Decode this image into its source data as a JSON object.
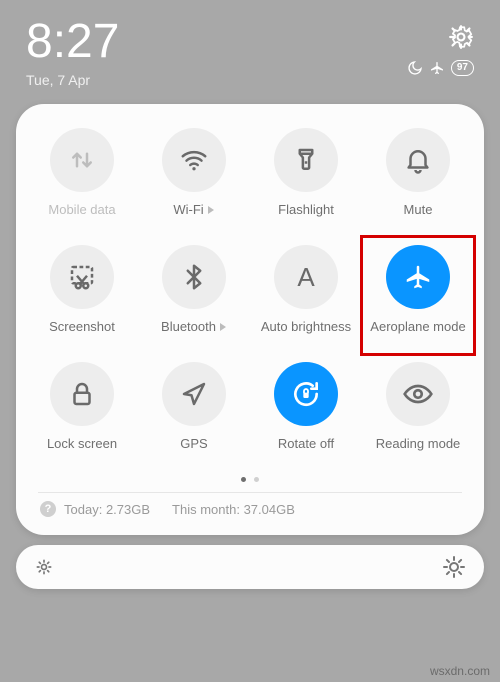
{
  "status": {
    "time": "8:27",
    "date": "Tue, 7 Apr",
    "battery": "97"
  },
  "tiles": {
    "mobile_data": "Mobile data",
    "wifi": "Wi-Fi",
    "flashlight": "Flashlight",
    "mute": "Mute",
    "screenshot": "Screenshot",
    "bluetooth": "Bluetooth",
    "auto_brightness": "Auto brightness",
    "aeroplane": "Aeroplane mode",
    "lock_screen": "Lock screen",
    "gps": "GPS",
    "rotate_off": "Rotate off",
    "reading_mode": "Reading mode"
  },
  "usage": {
    "today_label": "Today:",
    "today_value": "2.73GB",
    "month_label": "This month:",
    "month_value": "37.04GB"
  },
  "watermark": "wsxdn.com"
}
